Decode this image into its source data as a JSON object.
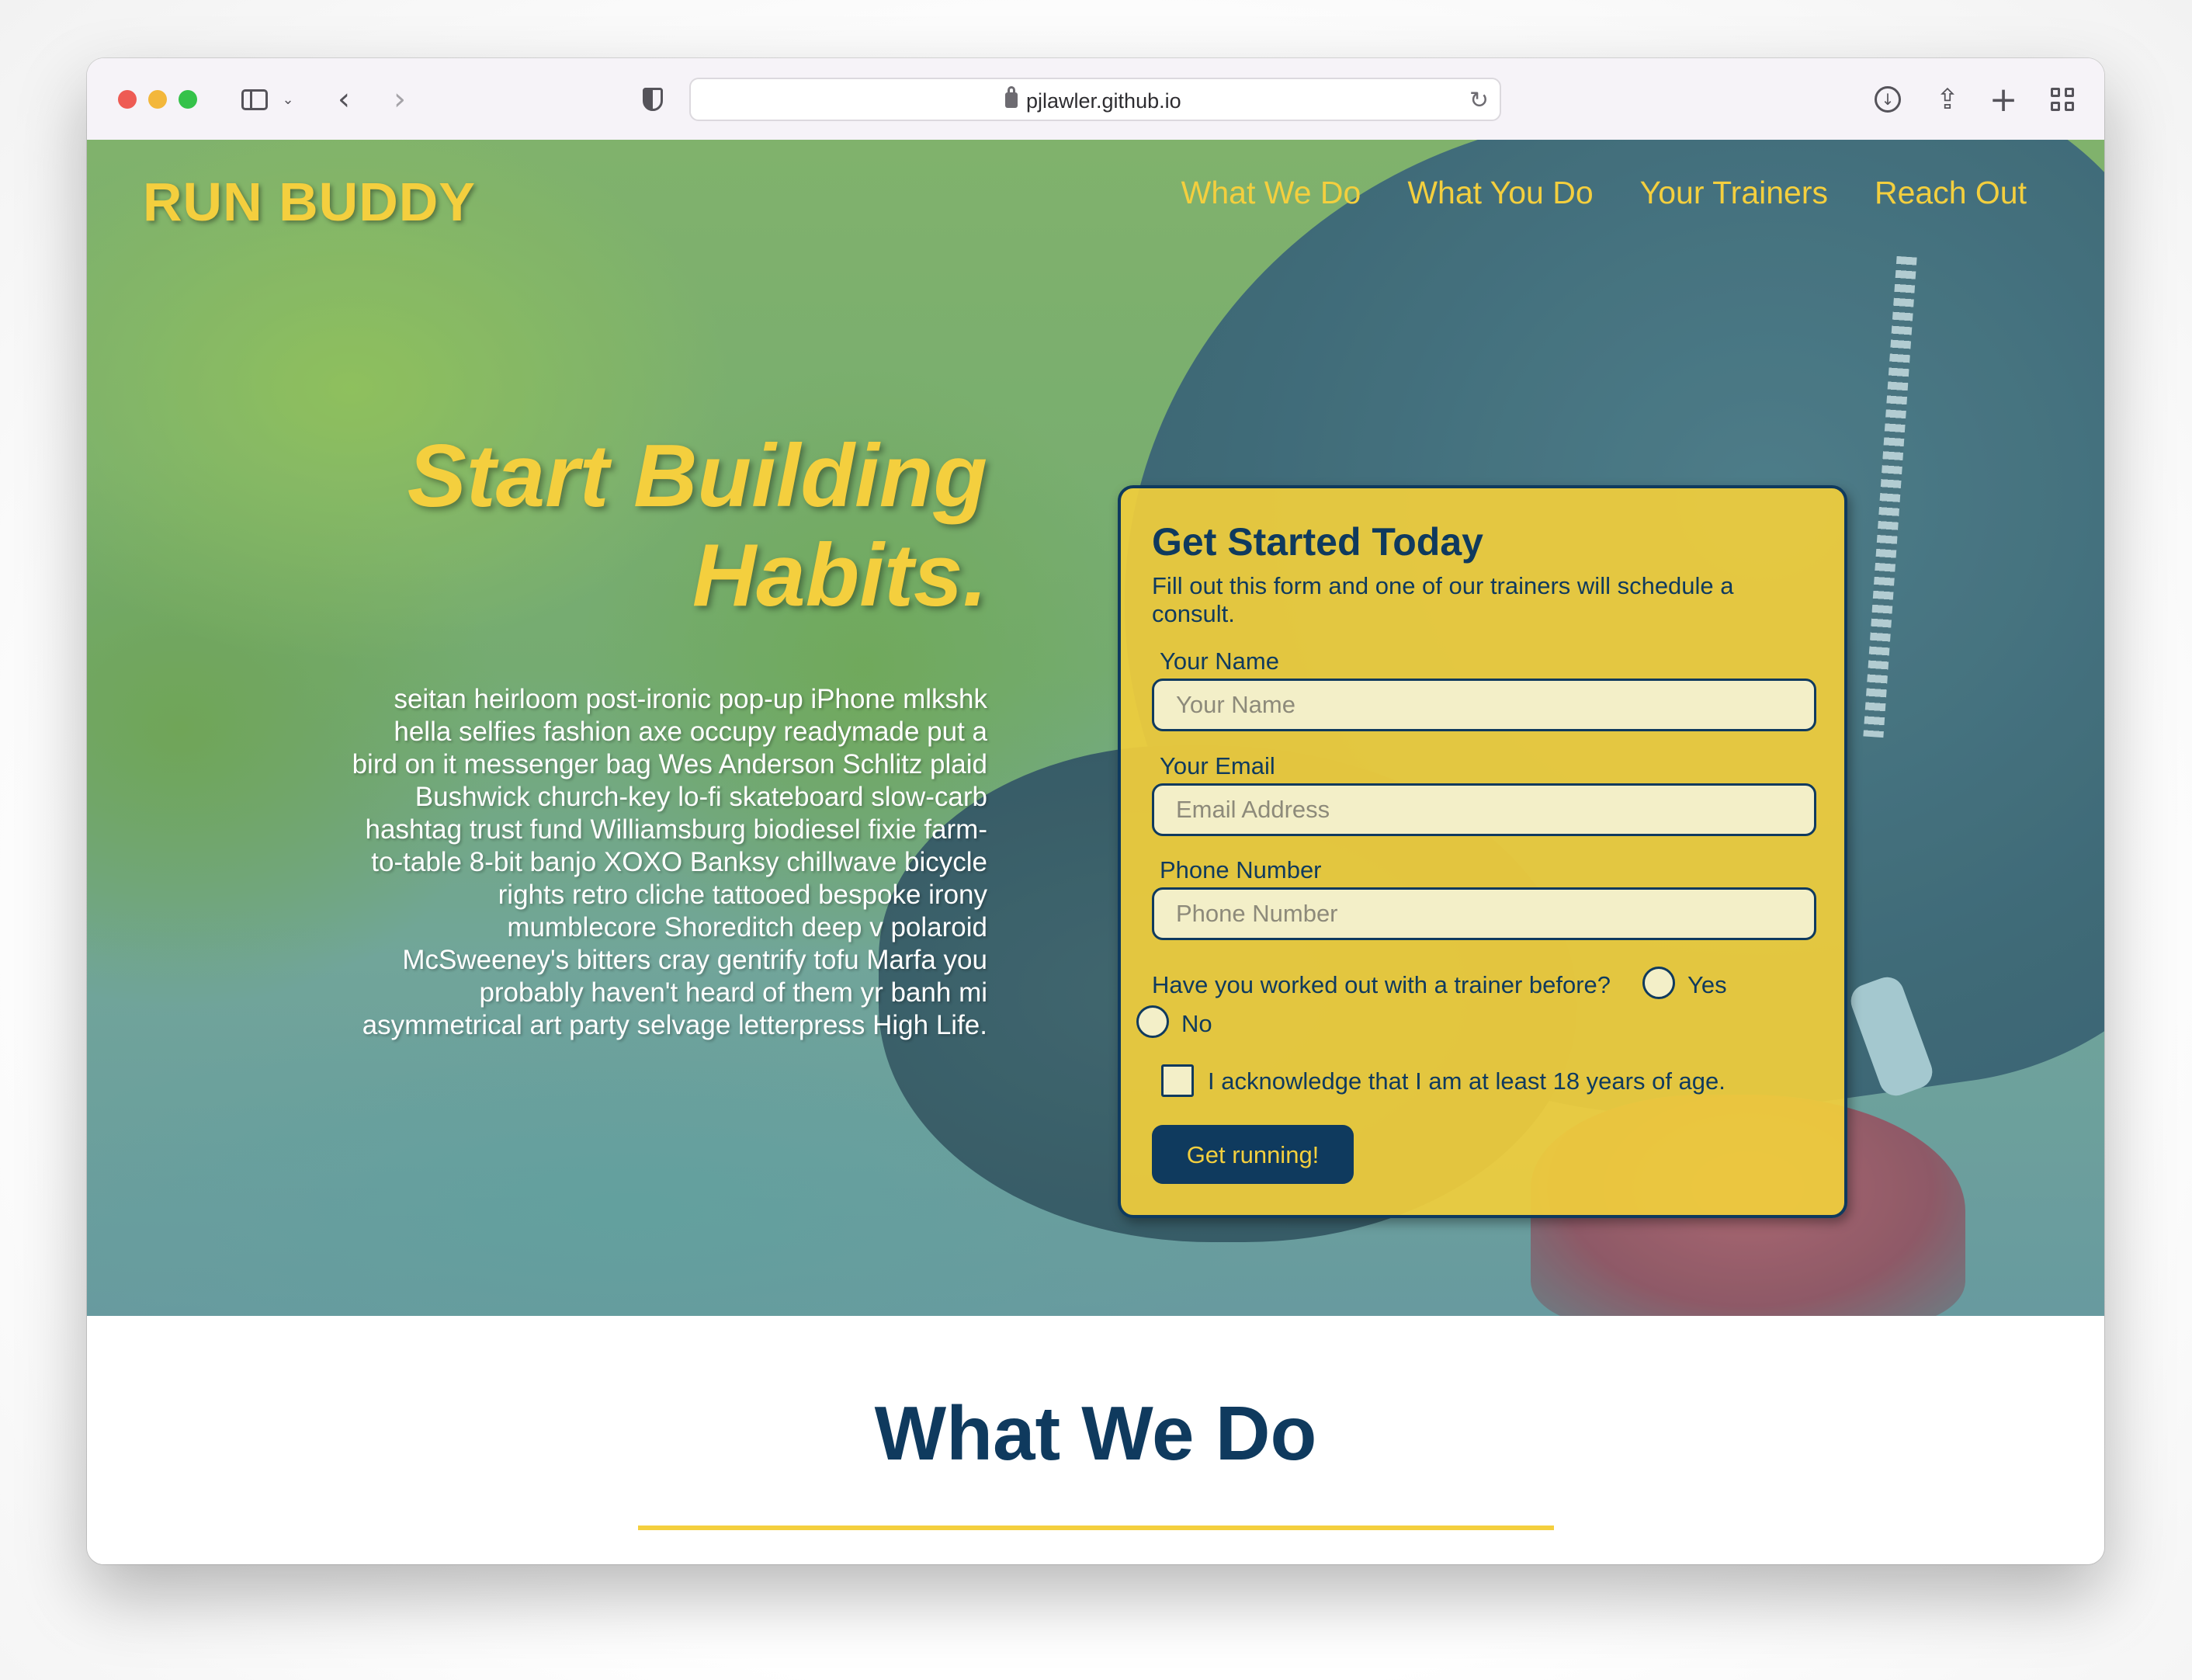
{
  "browser": {
    "url": "pjlawler.github.io"
  },
  "header": {
    "brand": "RUN BUDDY",
    "nav": [
      "What We Do",
      "What You Do",
      "Your Trainers",
      "Reach Out"
    ]
  },
  "hero": {
    "headline": "Start Building Habits.",
    "blurb": "seitan heirloom post-ironic pop-up iPhone mlkshk hella selfies fashion axe occupy readymade put a bird on it messenger bag Wes Anderson Schlitz plaid Bushwick church-key lo-fi skateboard slow-carb hashtag trust fund Williamsburg biodiesel fixie farm-to-table 8-bit banjo XOXO Banksy chillwave bicycle rights retro cliche tattooed bespoke irony mumblecore Shoreditch deep v polaroid McSweeney's bitters cray gentrify tofu Marfa you probably haven't heard of them yr banh mi asymmetrical art party selvage letterpress High Life."
  },
  "form": {
    "title": "Get Started Today",
    "subtitle": "Fill out this form and one of our trainers will schedule a consult.",
    "name_label": "Your Name",
    "name_placeholder": "Your Name",
    "email_label": "Your Email",
    "email_placeholder": "Email Address",
    "phone_label": "Phone Number",
    "phone_placeholder": "Phone Number",
    "question": "Have you worked out with a trainer before?",
    "option_yes": "Yes",
    "option_no": "No",
    "acknowledge": "I acknowledge that I am at least 18 years of age.",
    "submit": "Get running!"
  },
  "section": {
    "title": "What We Do"
  },
  "colors": {
    "accent": "#f4cf3e",
    "primary": "#0f3a5e"
  }
}
